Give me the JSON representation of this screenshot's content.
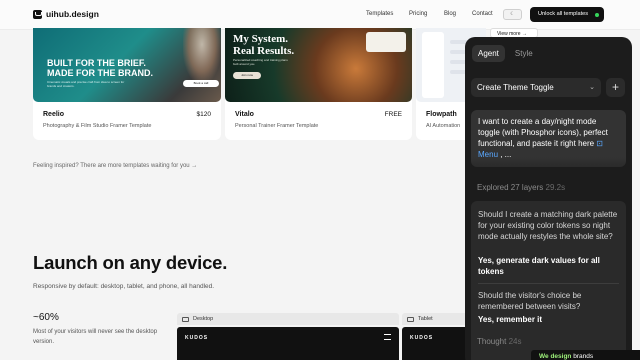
{
  "nav": {
    "logo": "uihub.design",
    "links": [
      "Templates",
      "Pricing",
      "Blog",
      "Contact"
    ],
    "toggle": "☾",
    "cta": "Unlock all templates"
  },
  "cards": [
    {
      "name": "Reelio",
      "price": "$120",
      "subtitle": "Photography & Film Studio Framer Template",
      "headline": [
        "BUILT FOR THE BRIEF.",
        "MADE FOR THE BRAND."
      ],
      "blurb": "Cinematic visuals and precise craft from idea to screen for brands and creators.",
      "pill": "Book a call"
    },
    {
      "name": "Vitalo",
      "price": "FREE",
      "subtitle": "Personal Trainer Framer Template",
      "headline": [
        "My System.",
        "Real Results."
      ],
      "blurb": "Personalized coaching and training plans built around you.",
      "pill": "Join now"
    },
    {
      "name": "Flowpath",
      "price": "",
      "subtitle": "AI Automation",
      "view": "View more →"
    }
  ],
  "inspired": "Feeling inspired? There are more templates waiting for you →",
  "launch": {
    "title": "Launch on any device.",
    "subtitle": "Responsive by default: desktop, tablet, and phone, all handled.",
    "stat": "~60%",
    "stat_desc": "Most of your visitors will never see the desktop version.",
    "tabs": [
      "Desktop",
      "Tablet"
    ],
    "frame_brand": "KUDOS"
  },
  "panel": {
    "tabs": [
      "Agent",
      "Style"
    ],
    "select": "Create Theme Toggle",
    "select_icon": "chevron-down-icon",
    "plus": "+",
    "prompt_pre": "I want to create a day/night mode toggle (with Phosphor icons), perfect functional, and paste it right here ",
    "prompt_chip": "⊡ Menu",
    "prompt_post": " , ...",
    "explored": "Explored 27 layers",
    "explored_time": "29.2s",
    "q1": "Should I create a matching dark palette for your existing color tokens so night mode actually restyles the whole site?",
    "a1": "Yes, generate dark values for all tokens",
    "q2": "Should the visitor's choice be remembered between visits?",
    "a2": "Yes, remember it",
    "thought": "Thought",
    "thought_time": "24s"
  },
  "badge": {
    "hl": "We design",
    "rest": "brands"
  },
  "colors": {
    "accent_green": "#36d65b",
    "panel_bg": "#1c1c1c",
    "link_blue": "#5aa8ff"
  }
}
